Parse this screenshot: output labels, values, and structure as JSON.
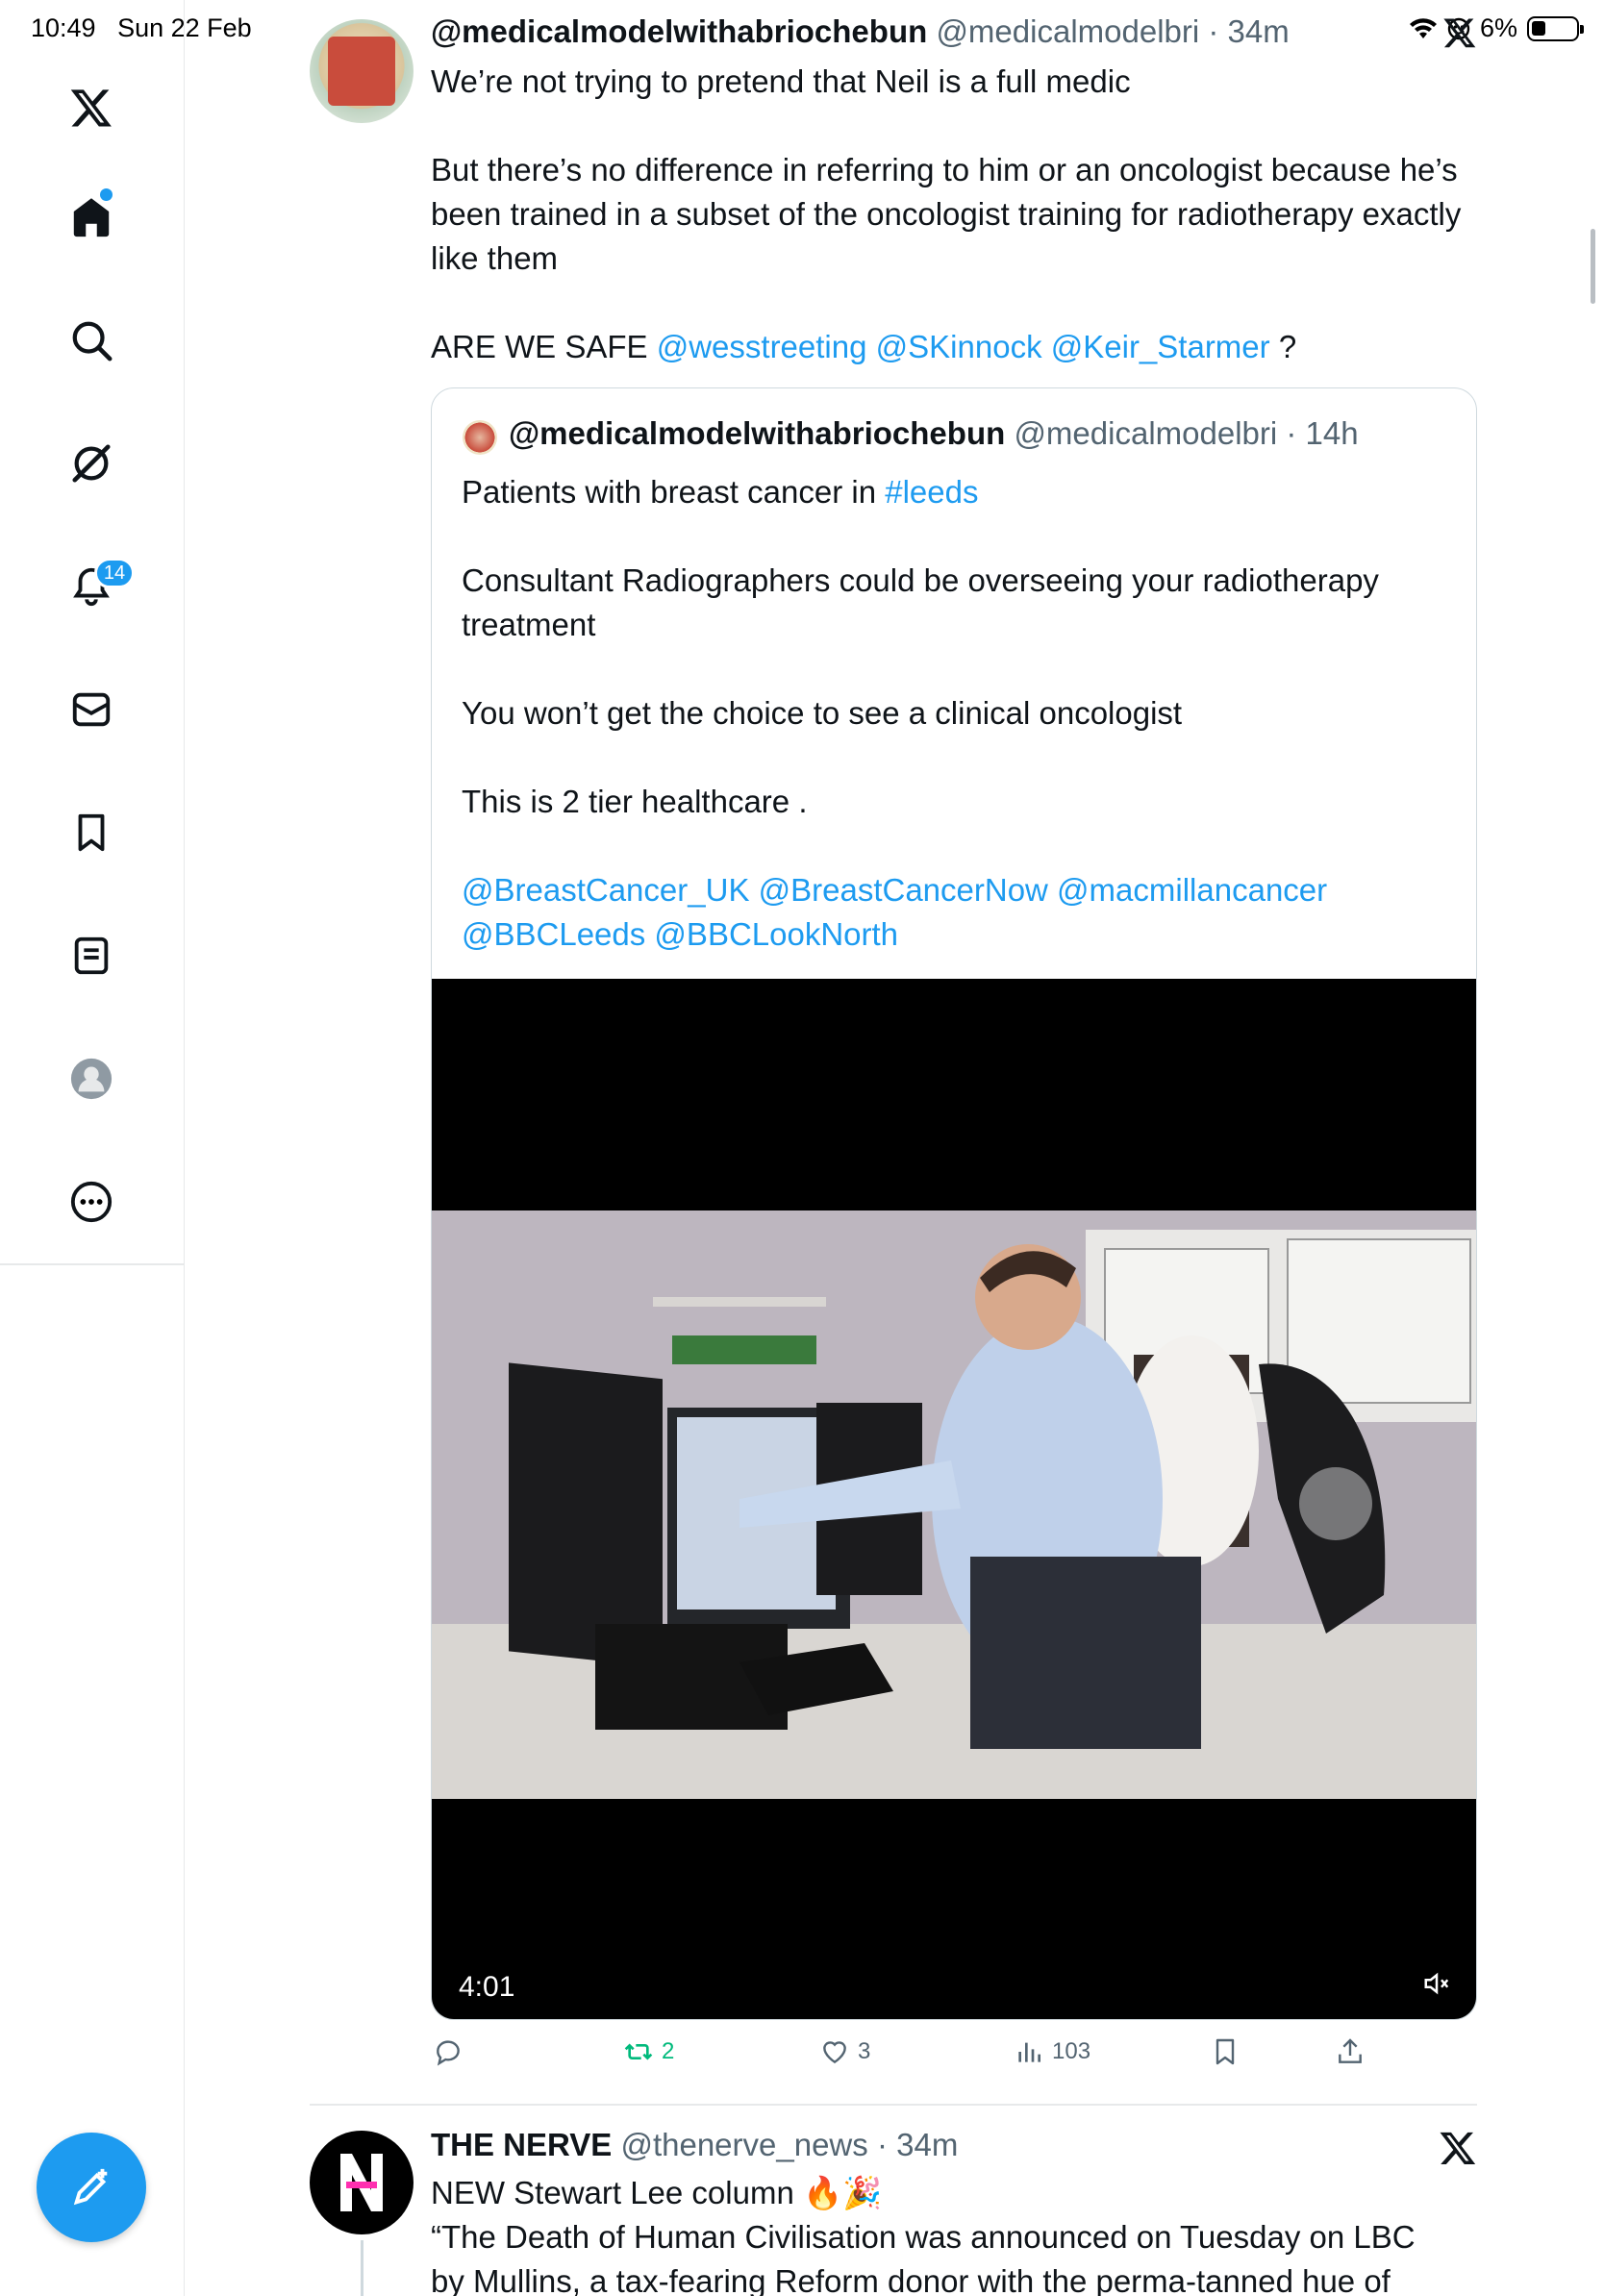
{
  "status_bar": {
    "time": "10:49",
    "date": "Sun 22 Feb",
    "battery": "6%"
  },
  "sidebar": {
    "notifications_badge": "14",
    "items": [
      "x-logo",
      "home",
      "search",
      "grok",
      "notifications",
      "messages",
      "bookmarks",
      "lists",
      "profile",
      "more"
    ]
  },
  "tweet": {
    "name": "@medicalmodelwithabriochebun",
    "handle": "@medicalmodelbri",
    "time": "34m",
    "paragraphs": [
      "We’re not trying to pretend that Neil is a full medic",
      "But there’s no difference in referring to him or an oncologist because he’s been trained in a subset of the oncologist training for radiotherapy exactly like them"
    ],
    "safe_text": "ARE WE SAFE",
    "mentions": [
      "@wesstreeting",
      "@SKinnock",
      "@Keir_Starmer"
    ],
    "safe_suffix": "?",
    "actions": {
      "reply": "",
      "retweets": "2",
      "likes": "3",
      "views": "103"
    }
  },
  "quote": {
    "name": "@medicalmodelwithabriochebun",
    "handle": "@medicalmodelbri",
    "time": "14h",
    "line1_text": "Patients with breast cancer in",
    "line1_hashtag": "#leeds",
    "paragraph2": "Consultant Radiographers could be overseeing your radiotherapy treatment",
    "paragraph3": "You won’t get the choice to see a clinical oncologist",
    "paragraph4": "This is 2 tier healthcare .",
    "mentions_line1": "@BreastCancer_UK @BreastCancerNow @macmillancancer",
    "mentions_line2": "@BBCLeeds @BBCLookNorth",
    "video_duration": "4:01"
  },
  "tweet2": {
    "name": "THE NERVE",
    "handle": "@thenerve_news",
    "time": "34m",
    "line1": "NEW Stewart Lee column 🔥🎉",
    "line2": "“The Death of Human Civilisation was announced on Tuesday on LBC",
    "line3": "by Mullins, a tax-fearing Reform donor with the perma-tanned hue of"
  },
  "colors": {
    "accent": "#1d9bf0",
    "text": "#0f1419",
    "muted": "#536471",
    "retweet": "#00ba7c"
  }
}
